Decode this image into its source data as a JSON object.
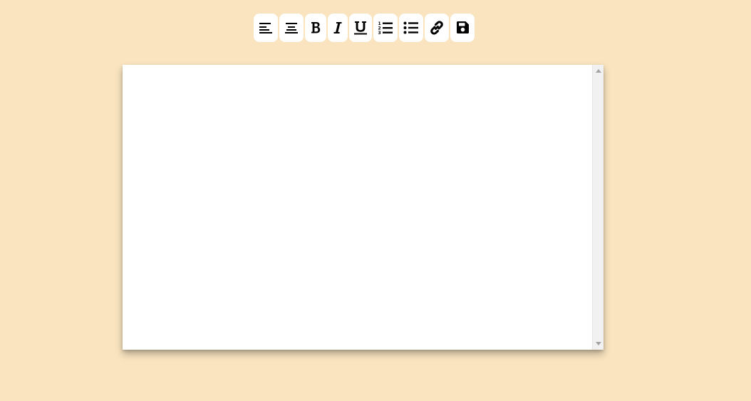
{
  "toolbar": {
    "buttons": [
      {
        "name": "align-left",
        "icon": "align-left-icon"
      },
      {
        "name": "align-center",
        "icon": "align-center-icon"
      },
      {
        "name": "bold",
        "icon": "bold-icon"
      },
      {
        "name": "italic",
        "icon": "italic-icon"
      },
      {
        "name": "underline",
        "icon": "underline-icon"
      },
      {
        "name": "ordered-list",
        "icon": "ordered-list-icon"
      },
      {
        "name": "unordered-list",
        "icon": "unordered-list-icon"
      },
      {
        "name": "link",
        "icon": "link-icon"
      },
      {
        "name": "save",
        "icon": "save-icon"
      }
    ]
  },
  "editor": {
    "content": ""
  },
  "colors": {
    "background": "#f9e4bf",
    "button": "#ffffff",
    "editor": "#ffffff",
    "scrollbar_track": "#f1f1f1",
    "icon": "#000000"
  }
}
